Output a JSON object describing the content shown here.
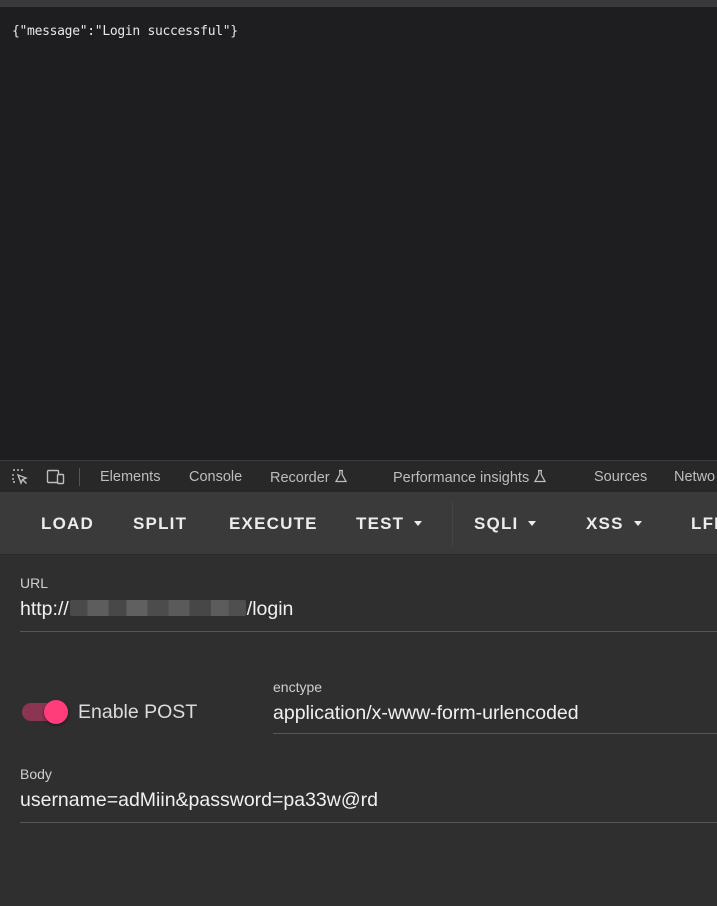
{
  "viewport": {
    "response_text": "{\"message\":\"Login successful\"}"
  },
  "devtools": {
    "icons": [
      "inspect-element-icon",
      "device-toolbar-icon",
      "flask-icon"
    ],
    "tabs": [
      "Elements",
      "Console",
      "Recorder",
      "Performance insights",
      "Sources",
      "Netwo"
    ]
  },
  "hackbar": {
    "toolbar": [
      "LOAD",
      "SPLIT",
      "EXECUTE",
      "TEST",
      "SQLI",
      "XSS",
      "LFI"
    ],
    "url": {
      "label": "URL",
      "prefix": "http://",
      "suffix": "/login"
    },
    "post": {
      "label": "Enable POST",
      "enabled": true
    },
    "enctype": {
      "label": "enctype",
      "value": "application/x-www-form-urlencoded"
    },
    "body": {
      "label": "Body",
      "value": "username=adMiin&password=pa33w@rd"
    }
  },
  "colors": {
    "accent": "#ff3d7a",
    "toggle_track": "#8b3553",
    "background": "#1e1e20",
    "panel": "#2f2f2f",
    "toolbar": "#3a3a3a"
  }
}
